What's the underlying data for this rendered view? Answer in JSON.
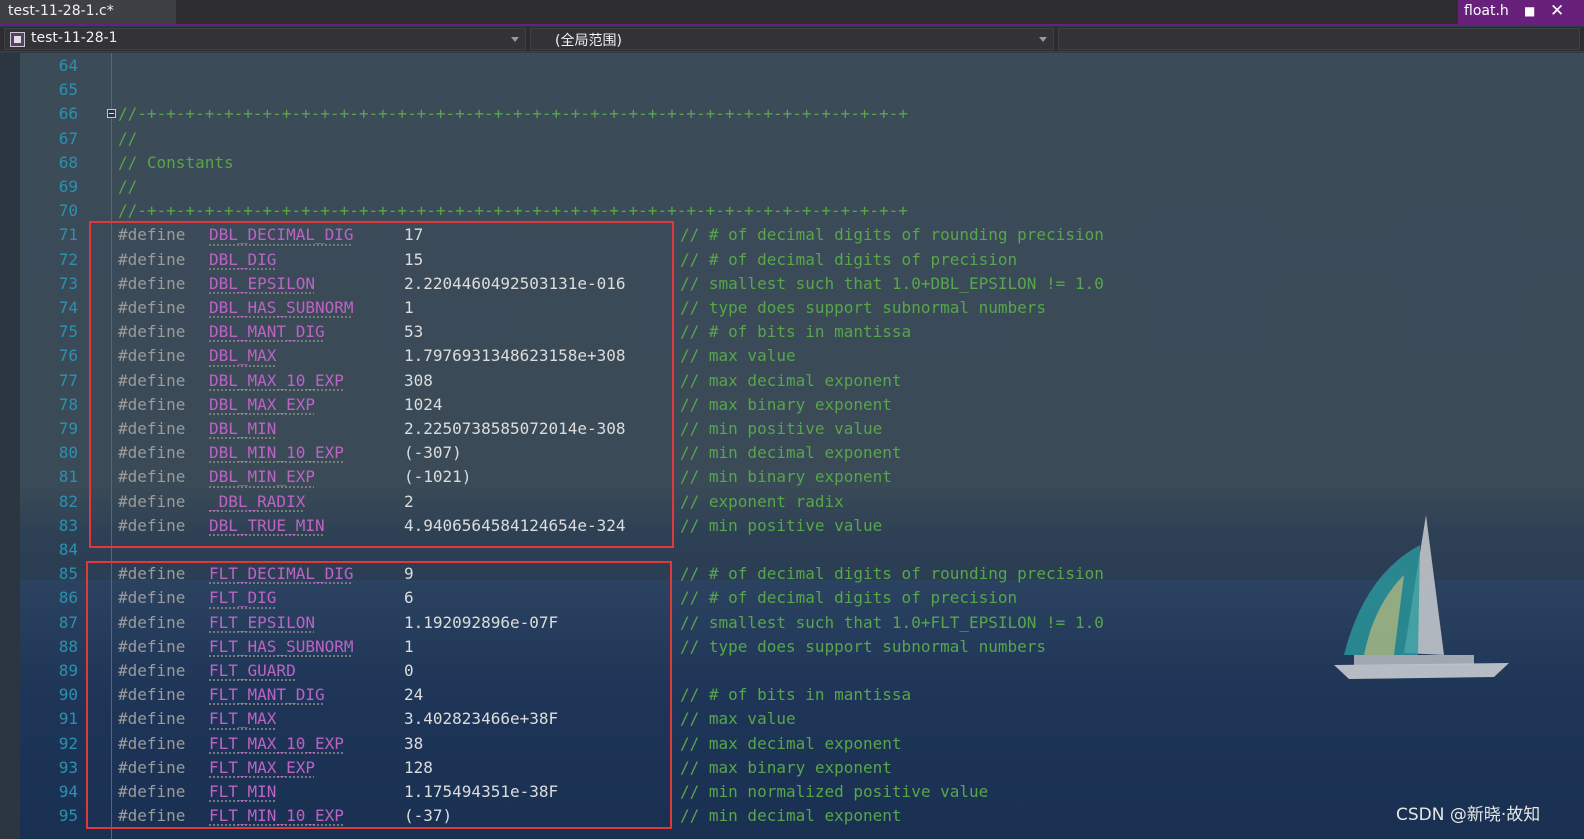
{
  "tabs": {
    "active_file": "test-11-28-1.c*",
    "other_file": "float.h",
    "pin_icon": "pin-icon",
    "close_icon": "close-icon"
  },
  "navbar": {
    "project": "test-11-28-1",
    "scope": "(全局范围)"
  },
  "colors": {
    "accent": "#68217a",
    "line_number": "#2b91af",
    "comment": "#57a64a",
    "macro": "#bd63c5",
    "directive": "#9b9b9b",
    "highlight_box": "#e0393b"
  },
  "editor": {
    "header_lines": [
      {
        "num": "64",
        "text": ""
      },
      {
        "num": "65",
        "text": ""
      },
      {
        "num": "66",
        "text": "//-+-+-+-+-+-+-+-+-+-+-+-+-+-+-+-+-+-+-+-+-+-+-+-+-+-+-+-+-+-+-+-+-+-+-+-+-+-+-+-+"
      },
      {
        "num": "67",
        "text": "//"
      },
      {
        "num": "68",
        "text": "// Constants"
      },
      {
        "num": "69",
        "text": "//"
      },
      {
        "num": "70",
        "text": "//-+-+-+-+-+-+-+-+-+-+-+-+-+-+-+-+-+-+-+-+-+-+-+-+-+-+-+-+-+-+-+-+-+-+-+-+-+-+-+-+"
      }
    ],
    "define_lines": [
      {
        "num": "71",
        "directive": "#define",
        "macro": "DBL_DECIMAL_DIG",
        "value": "17",
        "comment": "// # of decimal digits of rounding precision"
      },
      {
        "num": "72",
        "directive": "#define",
        "macro": "DBL_DIG",
        "value": "15",
        "comment": "// # of decimal digits of precision"
      },
      {
        "num": "73",
        "directive": "#define",
        "macro": "DBL_EPSILON",
        "value": "2.2204460492503131e-016",
        "comment": "// smallest such that 1.0+DBL_EPSILON != 1.0"
      },
      {
        "num": "74",
        "directive": "#define",
        "macro": "DBL_HAS_SUBNORM",
        "value": "1",
        "comment": "// type does support subnormal numbers"
      },
      {
        "num": "75",
        "directive": "#define",
        "macro": "DBL_MANT_DIG",
        "value": "53",
        "comment": "// # of bits in mantissa"
      },
      {
        "num": "76",
        "directive": "#define",
        "macro": "DBL_MAX",
        "value": "1.7976931348623158e+308",
        "comment": "// max value"
      },
      {
        "num": "77",
        "directive": "#define",
        "macro": "DBL_MAX_10_EXP",
        "value": "308",
        "comment": "// max decimal exponent"
      },
      {
        "num": "78",
        "directive": "#define",
        "macro": "DBL_MAX_EXP",
        "value": "1024",
        "comment": "// max binary exponent"
      },
      {
        "num": "79",
        "directive": "#define",
        "macro": "DBL_MIN",
        "value": "2.2250738585072014e-308",
        "comment": "// min positive value"
      },
      {
        "num": "80",
        "directive": "#define",
        "macro": "DBL_MIN_10_EXP",
        "value": "(-307)",
        "comment": "// min decimal exponent"
      },
      {
        "num": "81",
        "directive": "#define",
        "macro": "DBL_MIN_EXP",
        "value": "(-1021)",
        "comment": "// min binary exponent"
      },
      {
        "num": "82",
        "directive": "#define",
        "macro": "_DBL_RADIX",
        "value": "2",
        "comment": "// exponent radix"
      },
      {
        "num": "83",
        "directive": "#define",
        "macro": "DBL_TRUE_MIN",
        "value": "4.9406564584124654e-324",
        "comment": "// min positive value"
      },
      {
        "num": "84",
        "directive": "",
        "macro": "",
        "value": "",
        "comment": ""
      },
      {
        "num": "85",
        "directive": "#define",
        "macro": "FLT_DECIMAL_DIG",
        "value": "9",
        "comment": "// # of decimal digits of rounding precision"
      },
      {
        "num": "86",
        "directive": "#define",
        "macro": "FLT_DIG",
        "value": "6",
        "comment": "// # of decimal digits of precision"
      },
      {
        "num": "87",
        "directive": "#define",
        "macro": "FLT_EPSILON",
        "value": "1.192092896e-07F",
        "comment": "// smallest such that 1.0+FLT_EPSILON != 1.0"
      },
      {
        "num": "88",
        "directive": "#define",
        "macro": "FLT_HAS_SUBNORM",
        "value": "1",
        "comment": "// type does support subnormal numbers"
      },
      {
        "num": "89",
        "directive": "#define",
        "macro": "FLT_GUARD",
        "value": "0",
        "comment": ""
      },
      {
        "num": "90",
        "directive": "#define",
        "macro": "FLT_MANT_DIG",
        "value": "24",
        "comment": "// # of bits in mantissa"
      },
      {
        "num": "91",
        "directive": "#define",
        "macro": "FLT_MAX",
        "value": "3.402823466e+38F",
        "comment": "// max value"
      },
      {
        "num": "92",
        "directive": "#define",
        "macro": "FLT_MAX_10_EXP",
        "value": "38",
        "comment": "// max decimal exponent"
      },
      {
        "num": "93",
        "directive": "#define",
        "macro": "FLT_MAX_EXP",
        "value": "128",
        "comment": "// max binary exponent"
      },
      {
        "num": "94",
        "directive": "#define",
        "macro": "FLT_MIN",
        "value": "1.175494351e-38F",
        "comment": "// min normalized positive value"
      },
      {
        "num": "95",
        "directive": "#define",
        "macro": "FLT_MIN_10_EXP",
        "value": "(-37)",
        "comment": "// min decimal exponent"
      }
    ]
  },
  "watermark": "CSDN @新晓·故知"
}
